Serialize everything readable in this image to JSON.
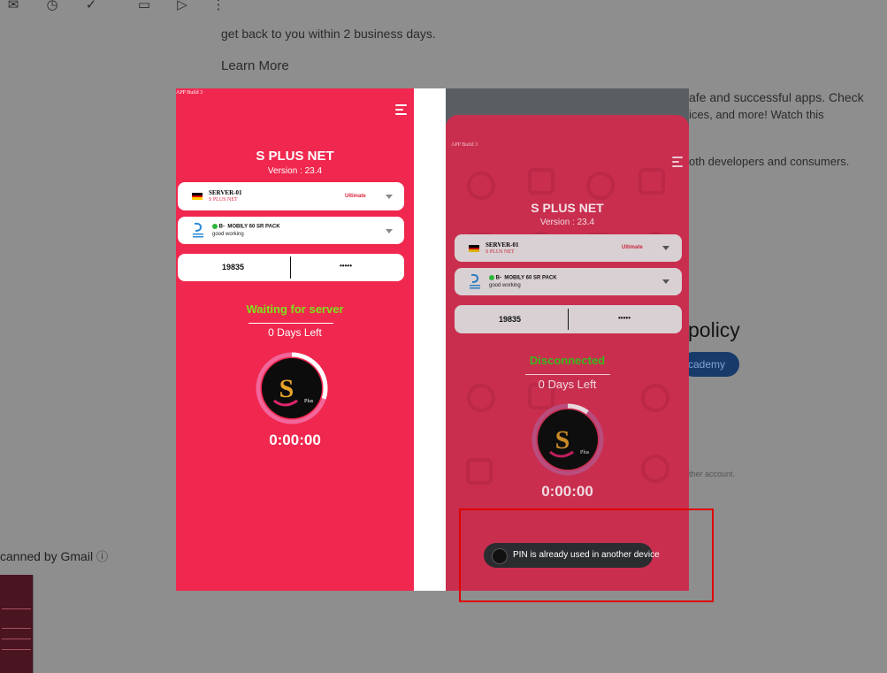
{
  "colors": {
    "app_red": "#f0274e",
    "app_red_dim": "#c92e4f",
    "status_waiting": "#7ee21c",
    "status_disconnected": "#39b81d",
    "highlight_box": "#e00000"
  },
  "background": {
    "toolbar_icons": [
      "mail-icon",
      "clock-icon",
      "add-task-icon",
      "move-to-icon",
      "label-icon",
      "more-vert-icon"
    ],
    "line1": "get back to you within 2 business days.",
    "learn_more": "Learn More",
    "right_frag1": "afe and successful apps. Check",
    "right_frag2": "ices, and more! Watch this",
    "right_frag3": "oth developers and consumers.",
    "policy_frag": "policy",
    "chip_frag": "cademy",
    "small_frag": "ther account.",
    "scanned_text": "canned by Gmail",
    "info_icon": "ⓘ"
  },
  "left_phone": {
    "app_build": "APP Build 3",
    "title": "S PLUS NET",
    "version": "Version : 23.4",
    "server_name": "SERVER-01",
    "server_sub": "S PLUS NET",
    "server_tag": "Ultimate",
    "package_name": "B-  MOBILY 60 SR PACK",
    "package_sub": "good working",
    "pin_left": "19835",
    "pin_right": "•••••",
    "status": "Waiting for server",
    "days_left": "0 Days Left",
    "timer": "0:00:00",
    "progress": 0.3
  },
  "right_phone": {
    "app_build": "APP Build 3",
    "title": "S PLUS NET",
    "version": "Version : 23.4",
    "server_name": "SERVER-01",
    "server_sub": "S PLUS NET",
    "server_tag": "Ultimate",
    "package_name": "B-  MOBILY 60 SR PACK",
    "package_sub": "good working",
    "pin_left": "19835",
    "pin_right": "•••••",
    "status": "Disconnected",
    "days_left": "0 Days Left",
    "timer": "0:00:00",
    "progress": 0.1
  },
  "toast": {
    "message": "PIN is already used in another device"
  }
}
